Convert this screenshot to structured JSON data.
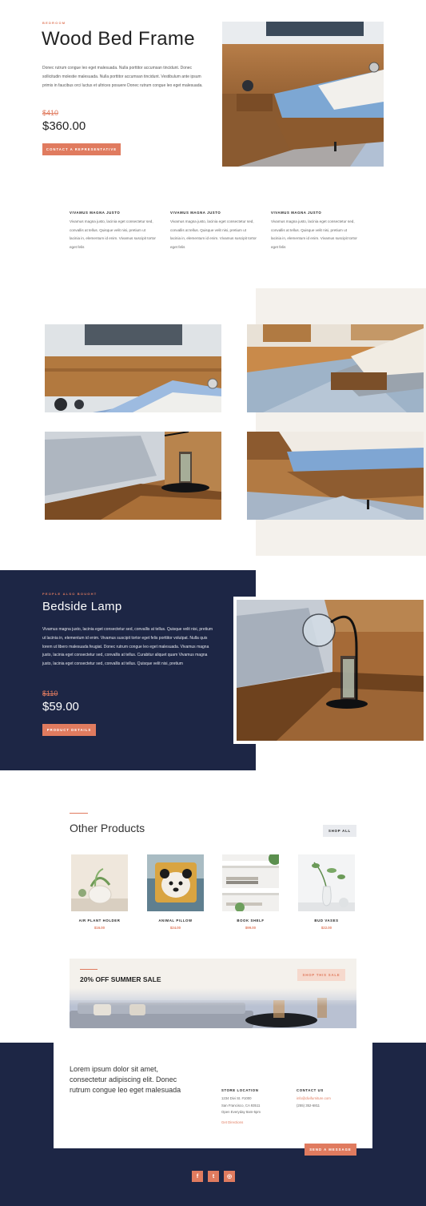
{
  "hero": {
    "eyebrow": "BEDROOM",
    "title": "Wood Bed Frame",
    "description": "Donec rutrum congue leo eget malesuada. Nulla porttitor accumsan tincidunt. Donec sollicitudin molestie malesuada. Nulla porttitor accumsan tincidunt. Vestibulum ante ipsum primis in faucibus orci luctus et ultrices posuere Donec rutrum congue leo eget malesuada.",
    "old_price": "$410",
    "price": "$360.00",
    "cta_label": "CONTACT A REPRESENTATIVE"
  },
  "features": [
    {
      "title": "VIVAMUS MAGNA JUSTO",
      "text": "Vivamus magna justo, lacinia eget consectetur sed, convallis at tellus. Quisque velit nisi, pretium ut lacinia in, elementum id enim. Vivamus suscipit tortor eget felis"
    },
    {
      "title": "VIVAMUS MAGNA JUSTO",
      "text": "Vivamus magna justo, lacinia eget consectetur sed, convallis at tellus. Quisque velit nisi, pretium ut lacinia in, elementum id enim. Vivamus suscipit tortor eget felis"
    },
    {
      "title": "VIVAMUS MAGNA JUSTO",
      "text": "Vivamus magna justo, lacinia eget consectetur sed, convallis at tellus. Quisque velit nisi, pretium ut lacinia in, elementum id enim. Vivamus suscipit tortor eget felis"
    }
  ],
  "also_bought": {
    "eyebrow": "PEOPLE ALSO BOUGHT",
    "title": "Bedside Lamp",
    "description": "Vivamus magna justo, lacinia eget consectetur sed, convallis at tellus. Quisque velit nisi, pretium ut lacinia in, elementum id enim. Vivamus suscipit tortor eget felis porttitor volutpat. Nulla quis lorem ut libero malesuada feugiat. Donec rutrum congue leo eget malesuada. Vivamus magna justo, lacinia eget consectetur sed, convallis at tellus. Curabitur aliquet quam Vivamus magna justo, lacinia eget consectetur sed, convallis at tellus. Quisque velit nisi, pretium",
    "old_price": "$110",
    "price": "$59.00",
    "button_label": "PRODUCT DETAILS"
  },
  "products_section": {
    "title": "Other Products",
    "shop_all_label": "SHOP ALL",
    "items": [
      {
        "name": "AIR PLANT HOLDER",
        "price": "$16.00"
      },
      {
        "name": "ANIMAL PILLOW",
        "price": "$24.00"
      },
      {
        "name": "BOOK SHELF",
        "price": "$99.00"
      },
      {
        "name": "BUD VASES",
        "price": "$22.00"
      }
    ]
  },
  "sale_banner": {
    "title": "20% OFF SUMMER SALE",
    "button_label": "SHOP THIS SALE"
  },
  "footer": {
    "tagline": "Lorem ipsum dolor sit amet, consectetur adipiscing elit. Donec rutrum congue leo eget malesuada",
    "store_heading": "STORE LOCATION",
    "store_address1": "1234 Divi St. #1000",
    "store_address2": "San Francisco, CA 93511",
    "store_hours": "Open Everyday 8am-5pm",
    "directions_label": "Get Directions",
    "contact_heading": "CONTACT US",
    "contact_email": "info@divifurniture.com",
    "contact_phone": "(255) 352-6811",
    "send_label": "SEND A MESSAGE",
    "social": {
      "facebook": "f",
      "twitter": "t",
      "instagram": "◎"
    }
  },
  "colors": {
    "accent": "#e07b5f",
    "navy": "#1d2645",
    "cream": "#f4f1ec"
  }
}
